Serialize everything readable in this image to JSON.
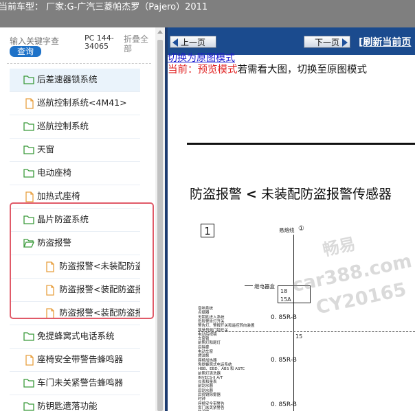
{
  "topbar": {
    "title": "当前车型： 厂家:G-广汽三菱帕杰罗（Pajero）2011"
  },
  "search": {
    "placeholder": "输入关键字查",
    "query_label": "查询",
    "pc_code": "PC 144-34065",
    "collapse_all": "折叠全部"
  },
  "tree": {
    "items": [
      {
        "label": "后差速器锁系统",
        "icon": "folder-icon",
        "level": 1,
        "selected": true
      },
      {
        "label": "巡航控制系统<4M41>",
        "icon": "document-icon",
        "level": 1
      },
      {
        "label": "巡航控制系统",
        "icon": "folder-icon",
        "level": 1
      },
      {
        "label": "天窗",
        "icon": "folder-icon",
        "level": 1
      },
      {
        "label": "电动座椅",
        "icon": "folder-icon",
        "level": 1
      },
      {
        "label": "加热式座椅",
        "icon": "document-icon",
        "level": 1
      },
      {
        "label": "晶片防盗系统",
        "icon": "folder-icon",
        "level": 1
      },
      {
        "label": "防盗报警",
        "icon": "folder-open-icon",
        "level": 1
      },
      {
        "label": "防盗报警<未装配防盗报",
        "icon": "document-icon",
        "level": 2
      },
      {
        "label": "防盗报警<装配防盗报警",
        "icon": "document-icon",
        "level": 2
      },
      {
        "label": "防盗报警<装配防盗报警",
        "icon": "document-icon",
        "level": 2
      },
      {
        "label": "免提蜂窝式电话系统",
        "icon": "folder-icon",
        "level": 1
      },
      {
        "label": "座椅安全带警告蜂鸣器",
        "icon": "document-icon",
        "level": 1
      },
      {
        "label": "车门未关紧警告蜂鸣器",
        "icon": "folder-icon",
        "level": 1
      },
      {
        "label": "防钥匙遗落功能",
        "icon": "folder-icon",
        "level": 1
      }
    ]
  },
  "nav": {
    "prev_label": "上一页",
    "next_label": "下一页",
    "refresh_label": "[刷新当前页"
  },
  "viewer": {
    "switch_link": "切换为原图模式",
    "mode_prefix": "当前：",
    "mode_name": "预览模式",
    "mode_hint": "若需看大图，切换至原图模式"
  },
  "document": {
    "title_part1": "防盗报警 ",
    "title_sym": "<",
    "title_part2": " 未装配防盗报警传感器",
    "diagram_number": "1",
    "wire_ignition": "易熔线",
    "wire_ignition_num": "①",
    "relay_box": "继电器盒",
    "fuse_num": "18",
    "fuse_rating": "15A",
    "wire_label_1": "0. 85R-B",
    "wire_label_2": "0. 85R-B",
    "wire_label_3": "0. 85R-B",
    "node_num": "15",
    "small_list": [
      "音响系统",
      "点烟器",
      "无钥匙进入系统",
      "危险警告灯开关",
      "警告灯、警报开关和遥控转向装置",
      "驾驶员侧门锁开关",
      "电动后视镜",
      "车窗锁",
      "前照灯和尾灯",
      "后除雾",
      "电动车窗",
      "燃油泵",
      "座椅加热器",
      "免提蜂窝式电话系统",
      "HBB、EBD、ABS 和 ASTC",
      "前照灯清洗器",
      "INVECS-II A/T",
      "仪表和量表",
      "前刮水器",
      "后刮水器",
      "后视镜除雾器",
      "时钟",
      "座椅安全带警告",
      "车门未关紧警告",
      "防盗锁",
      "SRS"
    ]
  },
  "watermark": {
    "line1": "畅易",
    "line2": "car388.com",
    "line3": "CY20165"
  },
  "colors": {
    "topbar_bg": "#7f7f7f",
    "nav_bg": "#1b4b8e",
    "query_btn": "#1e72c8",
    "highlight_border": "#e05a68",
    "folder_green": "#3a9a3a",
    "doc_orange": "#e8a040",
    "mode_red": "#e02020",
    "link_blue": "#1a1ad0"
  }
}
